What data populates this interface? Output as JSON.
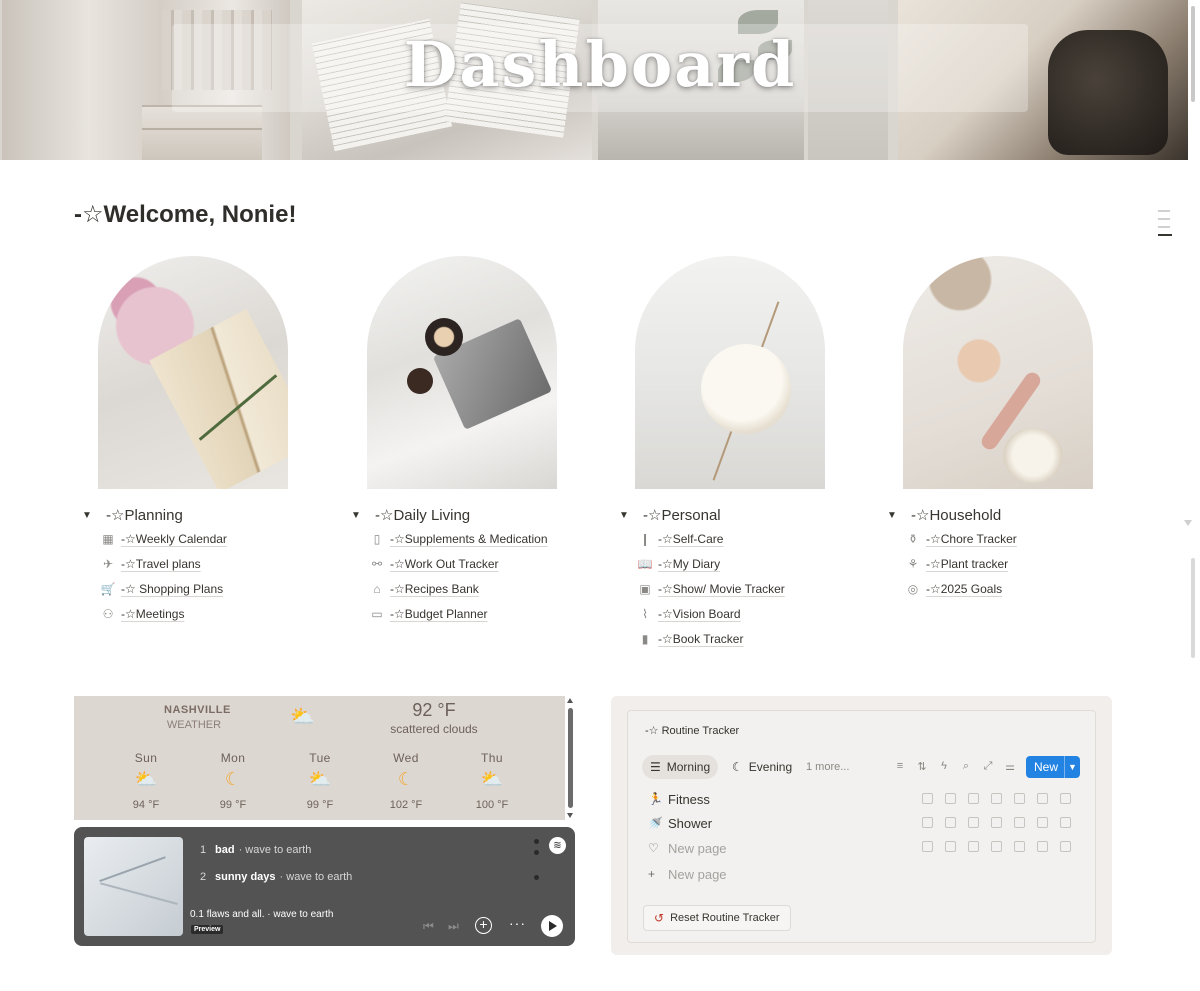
{
  "banner": {
    "title": "Dashboard"
  },
  "welcome": "-☆Welcome, Nonie!",
  "sections": [
    {
      "title": "-☆Planning",
      "items": [
        {
          "icon": "calendar-icon",
          "glyph": "▦",
          "label": "-☆Weekly Calendar"
        },
        {
          "icon": "airplane-icon",
          "glyph": "✈",
          "label": "-☆Travel plans"
        },
        {
          "icon": "shopping-cart-icon",
          "glyph": "🛒",
          "label": "-☆ Shopping Plans"
        },
        {
          "icon": "meeting-icon",
          "glyph": "⚇",
          "label": "-☆Meetings"
        }
      ]
    },
    {
      "title": "-☆Daily Living",
      "items": [
        {
          "icon": "pill-bottle-icon",
          "glyph": "▯",
          "label": "-☆Supplements & Medication"
        },
        {
          "icon": "dumbbell-icon",
          "glyph": "⚯",
          "label": "-☆Work Out Tracker"
        },
        {
          "icon": "basket-icon",
          "glyph": "⌂",
          "label": "-☆Recipes Bank"
        },
        {
          "icon": "cash-icon",
          "glyph": "▭",
          "label": "-☆Budget Planner"
        }
      ]
    },
    {
      "title": "-☆Personal",
      "items": [
        {
          "icon": "toothbrush-icon",
          "glyph": "❙",
          "label": "-☆Self-Care"
        },
        {
          "icon": "open-book-icon",
          "glyph": "📖",
          "label": "-☆My Diary"
        },
        {
          "icon": "tv-icon",
          "glyph": "▣",
          "label": "-☆Show/ Movie Tracker"
        },
        {
          "icon": "paperclip-icon",
          "glyph": "⌇",
          "label": "-☆Vision Board"
        },
        {
          "icon": "bookmark-icon",
          "glyph": "▮",
          "label": "-☆Book Tracker"
        }
      ]
    },
    {
      "title": "-☆Household",
      "items": [
        {
          "icon": "spray-bottle-icon",
          "glyph": "⚱",
          "label": "-☆Chore Tracker"
        },
        {
          "icon": "plant-icon",
          "glyph": "⚘",
          "label": "-☆Plant tracker"
        },
        {
          "icon": "target-icon",
          "glyph": "◎",
          "label": "-☆2025 Goals"
        }
      ]
    }
  ],
  "weather": {
    "city": "NASHVILLE",
    "subtitle": "WEATHER",
    "temp": "92 °F",
    "desc": "scattered clouds",
    "forecast": [
      {
        "day": "Sun",
        "temp": "94 °F",
        "icon": "sun-cloud-icon",
        "glyph": "⛅"
      },
      {
        "day": "Mon",
        "temp": "99 °F",
        "icon": "moon-icon",
        "glyph": "☾"
      },
      {
        "day": "Tue",
        "temp": "99 °F",
        "icon": "sun-cloud-icon",
        "glyph": "⛅"
      },
      {
        "day": "Wed",
        "temp": "102 °F",
        "icon": "moon-icon",
        "glyph": "☾"
      },
      {
        "day": "Thu",
        "temp": "100 °F",
        "icon": "sun-cloud-icon",
        "glyph": "⛅"
      }
    ]
  },
  "spotify": {
    "tracks": [
      {
        "num": "1",
        "name": "bad",
        "artist": "· wave to earth"
      },
      {
        "num": "2",
        "name": "sunny days",
        "artist": "· wave to earth"
      }
    ],
    "now_playing": "0.1 flaws and all. · wave to earth",
    "preview_label": "Preview",
    "logo_glyph": "≋"
  },
  "routine": {
    "title": "-☆ Routine Tracker",
    "tabs": [
      {
        "label": "Morning",
        "glyph": "☰"
      },
      {
        "label": "Evening",
        "glyph": "☾"
      },
      {
        "label": "1 more...",
        "glyph": ""
      }
    ],
    "new_label": "New",
    "rows": [
      {
        "label": "Fitness",
        "glyph": "🏃"
      },
      {
        "label": "Shower",
        "glyph": "🚿"
      },
      {
        "label": "New page",
        "glyph": "♡"
      },
      {
        "label": "New page",
        "glyph": "+"
      }
    ],
    "reset_label": "Reset Routine Tracker",
    "reset_glyph": "↺",
    "accent": "#2383e2"
  }
}
